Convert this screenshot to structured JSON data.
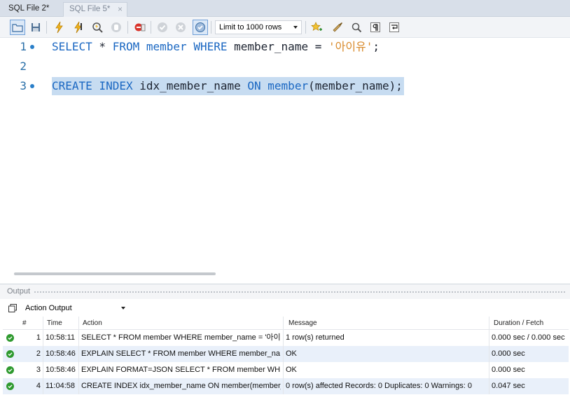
{
  "tabs": [
    {
      "label": "SQL File 2*"
    },
    {
      "label": "SQL File 5*",
      "close": "×"
    }
  ],
  "toolbar": {
    "limit_label": "Limit to 1000 rows"
  },
  "editor": {
    "lines": [
      {
        "number": "1",
        "parts": [
          {
            "t": "SELECT",
            "c": "kw"
          },
          {
            "t": " * ",
            "c": "plain"
          },
          {
            "t": "FROM",
            "c": "kw"
          },
          {
            "t": " ",
            "c": "plain"
          },
          {
            "t": "member",
            "c": "kw"
          },
          {
            "t": " ",
            "c": "plain"
          },
          {
            "t": "WHERE",
            "c": "kw"
          },
          {
            "t": " member_name = ",
            "c": "plain"
          },
          {
            "t": "'아이유'",
            "c": "str"
          },
          {
            "t": ";",
            "c": "plain"
          }
        ]
      },
      {
        "number": "2",
        "parts": []
      },
      {
        "number": "3",
        "parts": [
          {
            "t": "CREATE",
            "c": "kw"
          },
          {
            "t": " ",
            "c": "plain"
          },
          {
            "t": "INDEX",
            "c": "kw"
          },
          {
            "t": " idx_member_name ",
            "c": "plain"
          },
          {
            "t": "ON",
            "c": "kw"
          },
          {
            "t": " ",
            "c": "plain"
          },
          {
            "t": "member",
            "c": "kw"
          },
          {
            "t": "(member_name);",
            "c": "plain"
          }
        ]
      }
    ]
  },
  "output": {
    "title": "Output",
    "view_select": "Action Output",
    "columns": [
      "#",
      "Time",
      "Action",
      "Message",
      "Duration / Fetch"
    ],
    "rows": [
      {
        "num": "1",
        "time": "10:58:11",
        "action": "SELECT * FROM member WHERE member_name = '아이...",
        "message": "1 row(s) returned",
        "duration": "0.000 sec / 0.000 sec",
        "status": "ok"
      },
      {
        "num": "2",
        "time": "10:58:46",
        "action": "EXPLAIN SELECT * FROM member WHERE member_na...",
        "message": "OK",
        "duration": "0.000 sec",
        "status": "ok"
      },
      {
        "num": "3",
        "time": "10:58:46",
        "action": "EXPLAIN FORMAT=JSON SELECT * FROM member WH...",
        "message": "OK",
        "duration": "0.000 sec",
        "status": "ok"
      },
      {
        "num": "4",
        "time": "11:04:58",
        "action": "CREATE INDEX idx_member_name ON member(member_...",
        "message": "0 row(s) affected Records: 0  Duplicates: 0  Warnings: 0",
        "duration": "0.047 sec",
        "status": "ok"
      }
    ]
  }
}
